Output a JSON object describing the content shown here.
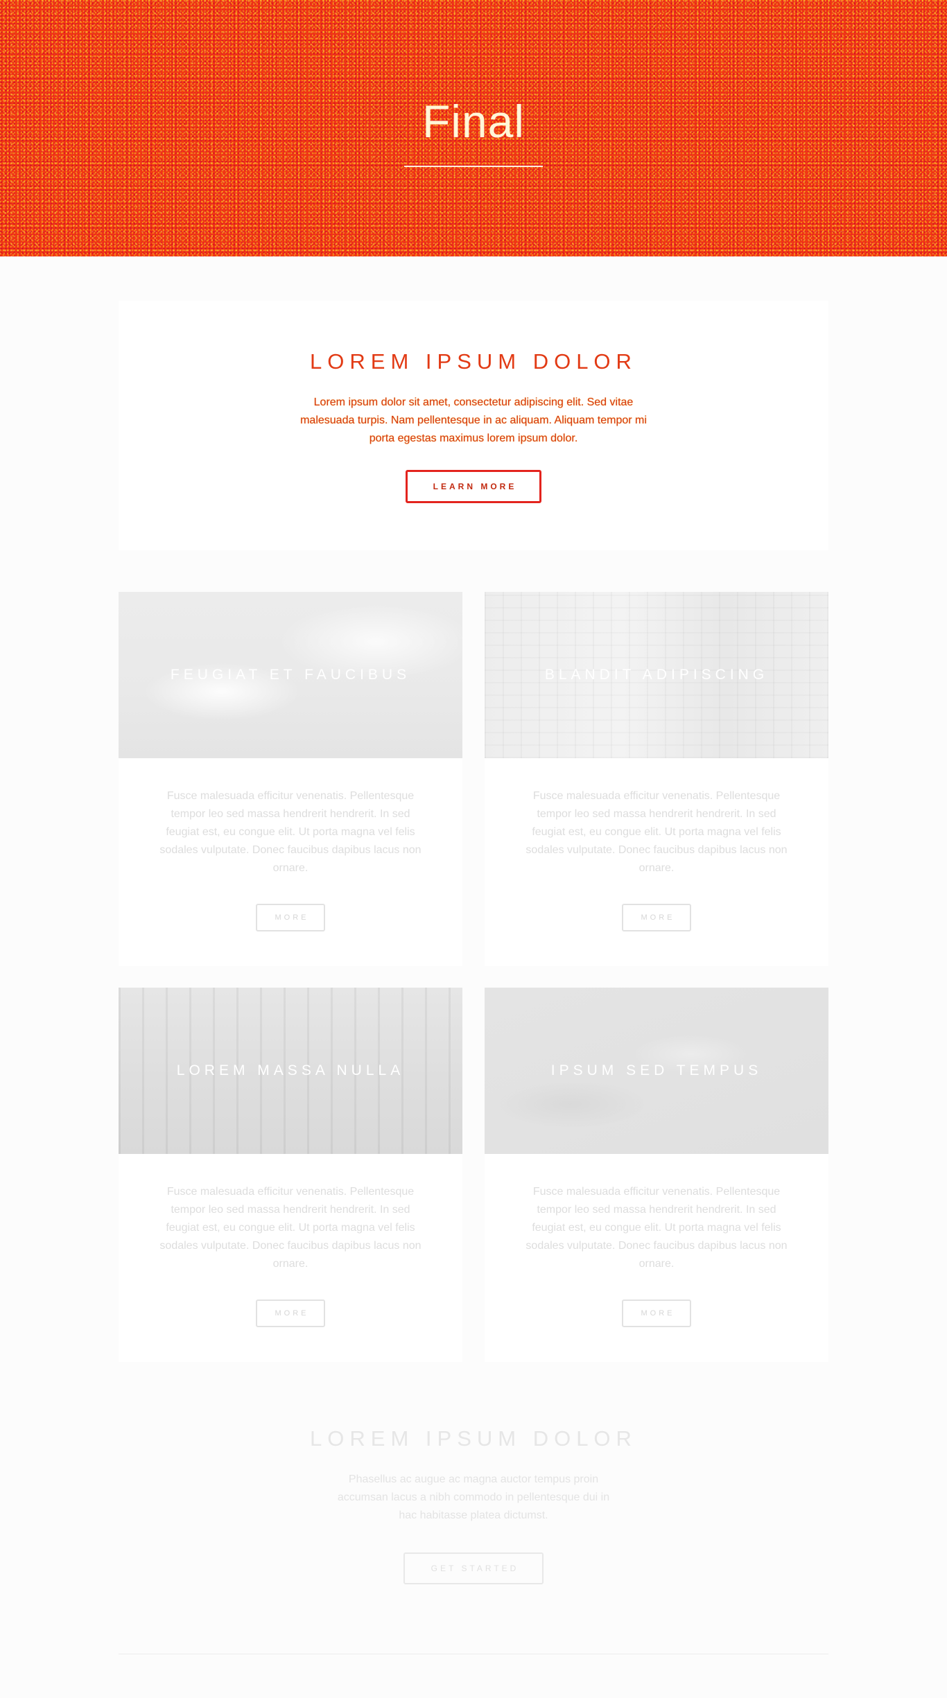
{
  "banner": {
    "title": "Final"
  },
  "intro": {
    "heading": "LOREM IPSUM DOLOR",
    "text": "Lorem ipsum dolor sit amet, consectetur adipiscing elit. Sed vitae malesuada turpis. Nam pellentesque in ac aliquam. Aliquam tempor mi porta egestas maximus lorem ipsum dolor.",
    "button_label": "LEARN MORE"
  },
  "cards": [
    {
      "title": "FEUGIAT ET FAUCIBUS",
      "text": "Fusce malesuada efficitur venenatis. Pellentesque tempor leo sed massa hendrerit hendrerit. In sed feugiat est, eu congue elit. Ut porta magna vel felis sodales vulputate. Donec faucibus dapibus lacus non ornare.",
      "button_label": "MORE"
    },
    {
      "title": "BLANDIT ADIPISCING",
      "text": "Fusce malesuada efficitur venenatis. Pellentesque tempor leo sed massa hendrerit hendrerit. In sed feugiat est, eu congue elit. Ut porta magna vel felis sodales vulputate. Donec faucibus dapibus lacus non ornare.",
      "button_label": "MORE"
    },
    {
      "title": "LOREM MASSA NULLA",
      "text": "Fusce malesuada efficitur venenatis. Pellentesque tempor leo sed massa hendrerit hendrerit. In sed feugiat est, eu congue elit. Ut porta magna vel felis sodales vulputate. Donec faucibus dapibus lacus non ornare.",
      "button_label": "MORE"
    },
    {
      "title": "IPSUM SED TEMPUS",
      "text": "Fusce malesuada efficitur venenatis. Pellentesque tempor leo sed massa hendrerit hendrerit. In sed feugiat est, eu congue elit. Ut porta magna vel felis sodales vulputate. Donec faucibus dapibus lacus non ornare.",
      "button_label": "MORE"
    }
  ],
  "cta": {
    "heading": "LOREM IPSUM DOLOR",
    "text": "Phasellus ac augue ac magna auctor tempus proin accumsan lacus a nibh commodo in pellentesque dui in hac habitasse platea dictumst.",
    "button_label": "GET STARTED"
  },
  "colors": {
    "banner_base": "#f23a10",
    "banner_speckle": "#ffdc28",
    "accent": "#e3241e",
    "intro_text": "#d8361a",
    "muted_text": "#dddddd"
  }
}
